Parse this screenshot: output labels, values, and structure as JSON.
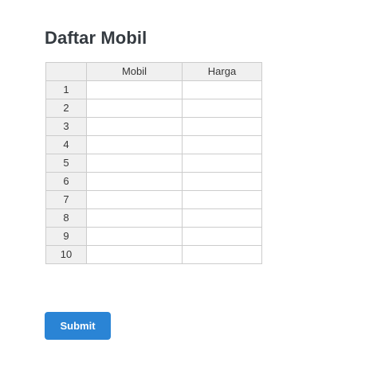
{
  "page": {
    "title": "Daftar Mobil"
  },
  "table": {
    "columns": [
      "Mobil",
      "Harga"
    ],
    "rows": [
      {
        "number": "1",
        "mobil": "",
        "harga": ""
      },
      {
        "number": "2",
        "mobil": "",
        "harga": ""
      },
      {
        "number": "3",
        "mobil": "",
        "harga": ""
      },
      {
        "number": "4",
        "mobil": "",
        "harga": ""
      },
      {
        "number": "5",
        "mobil": "",
        "harga": ""
      },
      {
        "number": "6",
        "mobil": "",
        "harga": ""
      },
      {
        "number": "7",
        "mobil": "",
        "harga": ""
      },
      {
        "number": "8",
        "mobil": "",
        "harga": ""
      },
      {
        "number": "9",
        "mobil": "",
        "harga": ""
      },
      {
        "number": "10",
        "mobil": "",
        "harga": ""
      }
    ]
  },
  "form": {
    "submit_label": "Submit"
  },
  "colors": {
    "accent": "#2a84d5",
    "title": "#343a40",
    "header_bg": "#f0f0f0",
    "grid_border": "#cccccc"
  }
}
